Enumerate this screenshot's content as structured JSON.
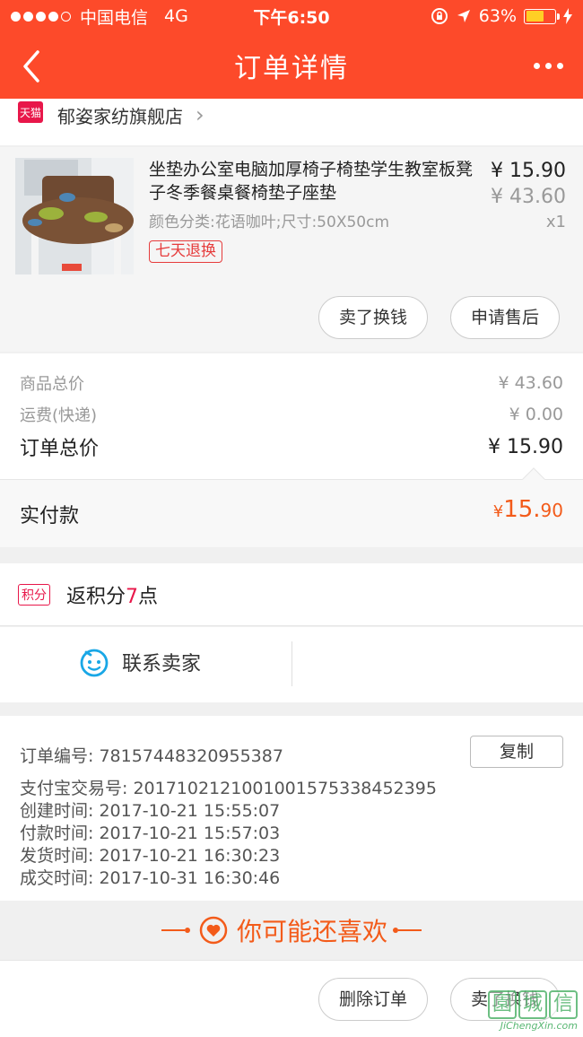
{
  "status_bar": {
    "carrier": "中国电信",
    "network": "4G",
    "time": "下午6:50",
    "battery": "63%",
    "battery_level": 0.63
  },
  "nav": {
    "title": "订单详情"
  },
  "store": {
    "badge": "天猫",
    "name": "郁姿家纺旗舰店"
  },
  "product": {
    "title": "坐垫办公室电脑加厚椅子椅垫学生教室板凳子冬季餐桌餐椅垫子座垫",
    "spec": "颜色分类:花语咖叶;尺寸:50X50cm",
    "tag": "七天退换",
    "price": "¥ 15.90",
    "original_price": "¥ 43.60",
    "quantity": "x1",
    "buttons": {
      "sell": "卖了换钱",
      "after_sale": "申请售后"
    }
  },
  "summary": {
    "goods_total_label": "商品总价",
    "goods_total": "¥ 43.60",
    "shipping_label": "运费(快递)",
    "shipping": "¥ 0.00",
    "order_total_label": "订单总价",
    "order_total": "¥ 15.90",
    "paid_label": "实付款",
    "paid_currency": "¥",
    "paid_int": "15.",
    "paid_dec": "90"
  },
  "points": {
    "badge": "积分",
    "prefix": "返积分",
    "num": "7",
    "suffix": "点"
  },
  "contact": {
    "label": "联系卖家"
  },
  "order_info": {
    "order_no": "订单编号:  78157448320955387",
    "alipay_no": "支付宝交易号:  2017102121001001575338452395",
    "created": "创建时间:  2017-10-21 15:55:07",
    "paid": "付款时间:  2017-10-21 15:57:03",
    "shipped": "发货时间:  2017-10-21 16:30:23",
    "completed": "成交时间:  2017-10-31 16:30:46",
    "copy_label": "复制"
  },
  "recommend": {
    "label": "你可能还喜欢"
  },
  "bottom_bar": {
    "delete": "删除订单",
    "sell": "卖了换钱"
  },
  "watermark": {
    "chars": [
      "園",
      "城",
      "信"
    ],
    "site": "JiChengXin.com"
  },
  "colors": {
    "brand": "#fd4a2a",
    "accent": "#f35b1a",
    "tmall": "#e8174a"
  }
}
